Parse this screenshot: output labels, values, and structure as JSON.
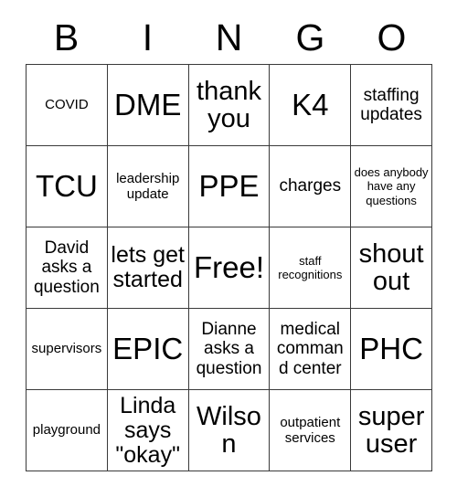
{
  "card": {
    "header_letters": [
      "B",
      "I",
      "N",
      "G",
      "O"
    ],
    "rows": [
      [
        {
          "text": "COVID",
          "size": "sm"
        },
        {
          "text": "DME",
          "size": "xxl"
        },
        {
          "text": "thank you",
          "size": "xl"
        },
        {
          "text": "K4",
          "size": "xxl"
        },
        {
          "text": "staffing updates",
          "size": "md"
        }
      ],
      [
        {
          "text": "TCU",
          "size": "xxl"
        },
        {
          "text": "leadership update",
          "size": "sm"
        },
        {
          "text": "PPE",
          "size": "xxl"
        },
        {
          "text": "charges",
          "size": "md"
        },
        {
          "text": "does anybody have any questions",
          "size": "xs"
        }
      ],
      [
        {
          "text": "David asks a question",
          "size": "md"
        },
        {
          "text": "lets get started",
          "size": "lg"
        },
        {
          "text": "Free!",
          "size": "xxl"
        },
        {
          "text": "staff recognitions",
          "size": "xs"
        },
        {
          "text": "shout out",
          "size": "xl"
        }
      ],
      [
        {
          "text": "supervisors",
          "size": "sm"
        },
        {
          "text": "EPIC",
          "size": "xxl"
        },
        {
          "text": "Dianne asks a question",
          "size": "md"
        },
        {
          "text": "medical command center",
          "size": "md"
        },
        {
          "text": "PHC",
          "size": "xxl"
        }
      ],
      [
        {
          "text": "playground",
          "size": "sm"
        },
        {
          "text": "Linda says \"okay\"",
          "size": "lg"
        },
        {
          "text": "Wilson",
          "size": "xl"
        },
        {
          "text": "outpatient services",
          "size": "sm"
        },
        {
          "text": "super user",
          "size": "xl"
        }
      ]
    ],
    "colors": {
      "background": "#ffffff",
      "border": "#3a3a3a",
      "text": "#000000"
    }
  }
}
